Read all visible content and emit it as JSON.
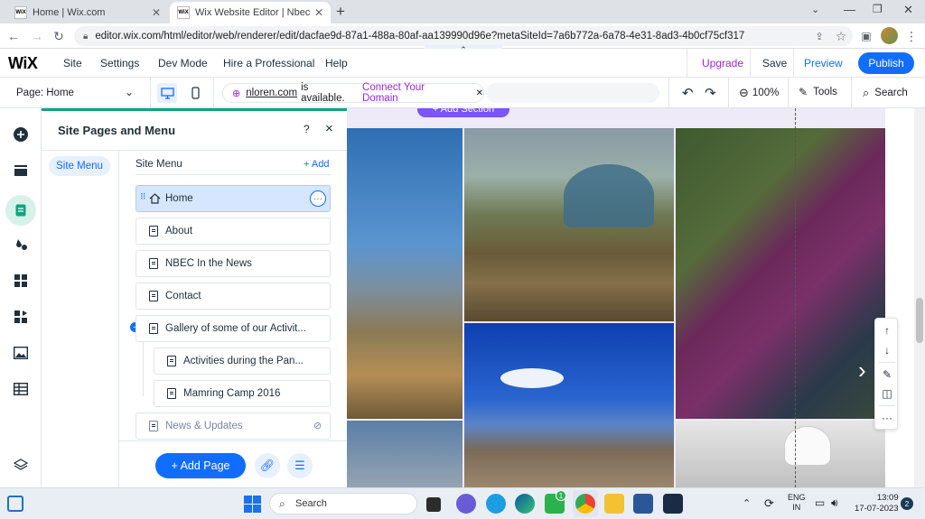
{
  "browser": {
    "tabs": [
      {
        "label": "Home | Wix.com",
        "favicon": "WiX"
      },
      {
        "label": "Wix Website Editor | Nbec",
        "favicon": "WiX"
      }
    ],
    "new_tab": "+",
    "url": "editor.wix.com/html/editor/web/renderer/edit/dacfae9d-87a1-488a-80af-aa139990d96e?metaSiteId=7a6b772a-6a78-4e31-8ad3-4b0cf75cf317"
  },
  "wix_bar": {
    "logo": "WiX",
    "menu": [
      "Site",
      "Settings",
      "Dev Mode",
      "Hire a Professional",
      "Help"
    ],
    "upgrade": "Upgrade",
    "save": "Save",
    "preview": "Preview",
    "publish": "Publish"
  },
  "toolbar": {
    "page_selector": "Page: Home",
    "domain": "nloren.com",
    "domain_suffix": "is available.",
    "connect": "Connect Your Domain",
    "zoom": "100%",
    "tools": "Tools",
    "search": "Search"
  },
  "panel": {
    "title": "Site Pages and Menu",
    "help": "?",
    "close": "×",
    "subnav": "Site Menu",
    "list_title": "Site Menu",
    "add": "+ Add",
    "pages": [
      {
        "label": "Home"
      },
      {
        "label": "About"
      },
      {
        "label": "NBEC In the News"
      },
      {
        "label": "Contact"
      },
      {
        "label": "Gallery of some of our Activit..."
      },
      {
        "label": "Activities during the Pan..."
      },
      {
        "label": "Mamring Camp 2016"
      },
      {
        "label": "News & Updates"
      }
    ],
    "add_page": "+ Add Page"
  },
  "canvas": {
    "add_section": "+ Add Section"
  },
  "taskbar": {
    "search": "Search",
    "lang_top": "ENG",
    "lang_bottom": "IN",
    "time": "13:09",
    "date": "17-07-2023",
    "notifications": "2",
    "whatsapp_badge": "1"
  },
  "colors": {
    "wix_blue": "#116dff",
    "panel_accent": "#0fa47f",
    "upgrade_purple": "#9a27d5",
    "add_section_purple": "#7b55f5"
  }
}
